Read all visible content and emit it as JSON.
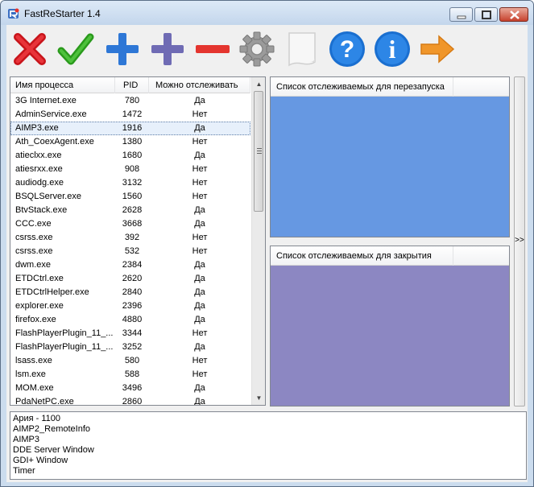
{
  "window": {
    "title": "FastReStarter 1.4"
  },
  "toolbar": {
    "buttons": [
      {
        "icon": "red-x-icon"
      },
      {
        "icon": "green-check-icon"
      },
      {
        "icon": "blue-plus-icon"
      },
      {
        "icon": "purple-plus-icon"
      },
      {
        "icon": "red-minus-icon"
      },
      {
        "icon": "gear-icon"
      },
      {
        "icon": "notepad-icon"
      },
      {
        "icon": "help-icon"
      },
      {
        "icon": "info-icon"
      },
      {
        "icon": "arrow-right-icon"
      }
    ]
  },
  "process_list": {
    "headers": {
      "name": "Имя процесса",
      "pid": "PID",
      "monitor": "Можно отслеживать"
    },
    "rows": [
      {
        "name": "3G Internet.exe",
        "pid": "780",
        "monitor": "Да"
      },
      {
        "name": "AdminService.exe",
        "pid": "1472",
        "monitor": "Нет"
      },
      {
        "name": "AIMP3.exe",
        "pid": "1916",
        "monitor": "Да"
      },
      {
        "name": "Ath_CoexAgent.exe",
        "pid": "1380",
        "monitor": "Нет"
      },
      {
        "name": "atieclxx.exe",
        "pid": "1680",
        "monitor": "Да"
      },
      {
        "name": "atiesrxx.exe",
        "pid": "908",
        "monitor": "Нет"
      },
      {
        "name": "audiodg.exe",
        "pid": "3132",
        "monitor": "Нет"
      },
      {
        "name": "BSQLServer.exe",
        "pid": "1560",
        "monitor": "Нет"
      },
      {
        "name": "BtvStack.exe",
        "pid": "2628",
        "monitor": "Да"
      },
      {
        "name": "CCC.exe",
        "pid": "3668",
        "monitor": "Да"
      },
      {
        "name": "csrss.exe",
        "pid": "392",
        "monitor": "Нет"
      },
      {
        "name": "csrss.exe",
        "pid": "532",
        "monitor": "Нет"
      },
      {
        "name": "dwm.exe",
        "pid": "2384",
        "monitor": "Да"
      },
      {
        "name": "ETDCtrl.exe",
        "pid": "2620",
        "monitor": "Да"
      },
      {
        "name": "ETDCtrlHelper.exe",
        "pid": "2840",
        "monitor": "Да"
      },
      {
        "name": "explorer.exe",
        "pid": "2396",
        "monitor": "Да"
      },
      {
        "name": "firefox.exe",
        "pid": "4880",
        "monitor": "Да"
      },
      {
        "name": "FlashPlayerPlugin_11_...",
        "pid": "3344",
        "monitor": "Нет"
      },
      {
        "name": "FlashPlayerPlugin_11_...",
        "pid": "3252",
        "monitor": "Да"
      },
      {
        "name": "lsass.exe",
        "pid": "580",
        "monitor": "Нет"
      },
      {
        "name": "lsm.exe",
        "pid": "588",
        "monitor": "Нет"
      },
      {
        "name": "MOM.exe",
        "pid": "3496",
        "monitor": "Да"
      },
      {
        "name": "PdaNetPC.exe",
        "pid": "2860",
        "monitor": "Да"
      }
    ],
    "selected_index": 2
  },
  "restart_list": {
    "header": "Список отслеживаемых для перезапуска",
    "color": "#6698e2"
  },
  "close_list": {
    "header": "Список отслеживаемых для закрытия",
    "color": "#8c87c2"
  },
  "expand_button": {
    "label": ">>"
  },
  "window_texts": [
    "Ария - 1100",
    "AIMP2_RemoteInfo",
    "AIMP3",
    "DDE Server Window",
    "GDI+ Window",
    "Timer"
  ]
}
